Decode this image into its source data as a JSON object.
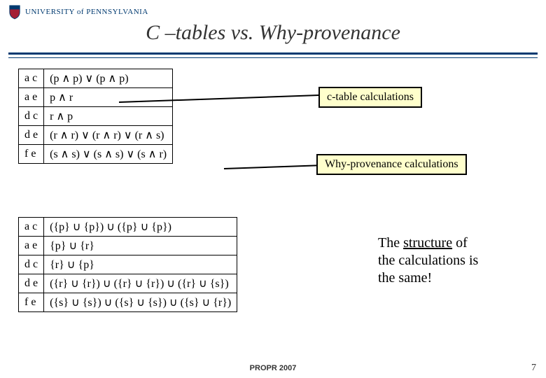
{
  "header": {
    "university": "UNIVERSITY of PENNSYLVANIA"
  },
  "title": "C –tables vs. Why-provenance",
  "table1": {
    "rows": [
      {
        "k1": "a",
        "k2": "c",
        "expr": "(p ∧ p) ∨ (p ∧ p)"
      },
      {
        "k1": "a",
        "k2": "e",
        "expr": "p ∧ r"
      },
      {
        "k1": "d",
        "k2": "c",
        "expr": "r ∧ p"
      },
      {
        "k1": "d",
        "k2": "e",
        "expr": "(r ∧ r) ∨ (r ∧ r) ∨ (r ∧ s)"
      },
      {
        "k1": "f",
        "k2": "e",
        "expr": "(s ∧ s) ∨ (s ∧ s) ∨ (s ∧ r)"
      }
    ]
  },
  "table2": {
    "rows": [
      {
        "k1": "a",
        "k2": "c",
        "expr": "({p} ∪ {p}) ∪ ({p} ∪ {p})"
      },
      {
        "k1": "a",
        "k2": "e",
        "expr": "{p} ∪ {r}"
      },
      {
        "k1": "d",
        "k2": "c",
        "expr": "{r} ∪ {p}"
      },
      {
        "k1": "d",
        "k2": "e",
        "expr": "({r} ∪ {r}) ∪ ({r} ∪ {r}) ∪ ({r} ∪ {s})"
      },
      {
        "k1": "f",
        "k2": "e",
        "expr": "({s} ∪ {s}) ∪ ({s} ∪ {s}) ∪ ({s} ∪ {r})"
      }
    ]
  },
  "callouts": {
    "ctable": "c-table calculations",
    "whyprov": "Why-provenance calculations"
  },
  "note": {
    "line1_pre": "The ",
    "line1_u": "structure",
    "line1_post": " of",
    "line2": "the calculations is",
    "line3": "the same!"
  },
  "footer": "PROPR 2007",
  "pagenum": "7"
}
